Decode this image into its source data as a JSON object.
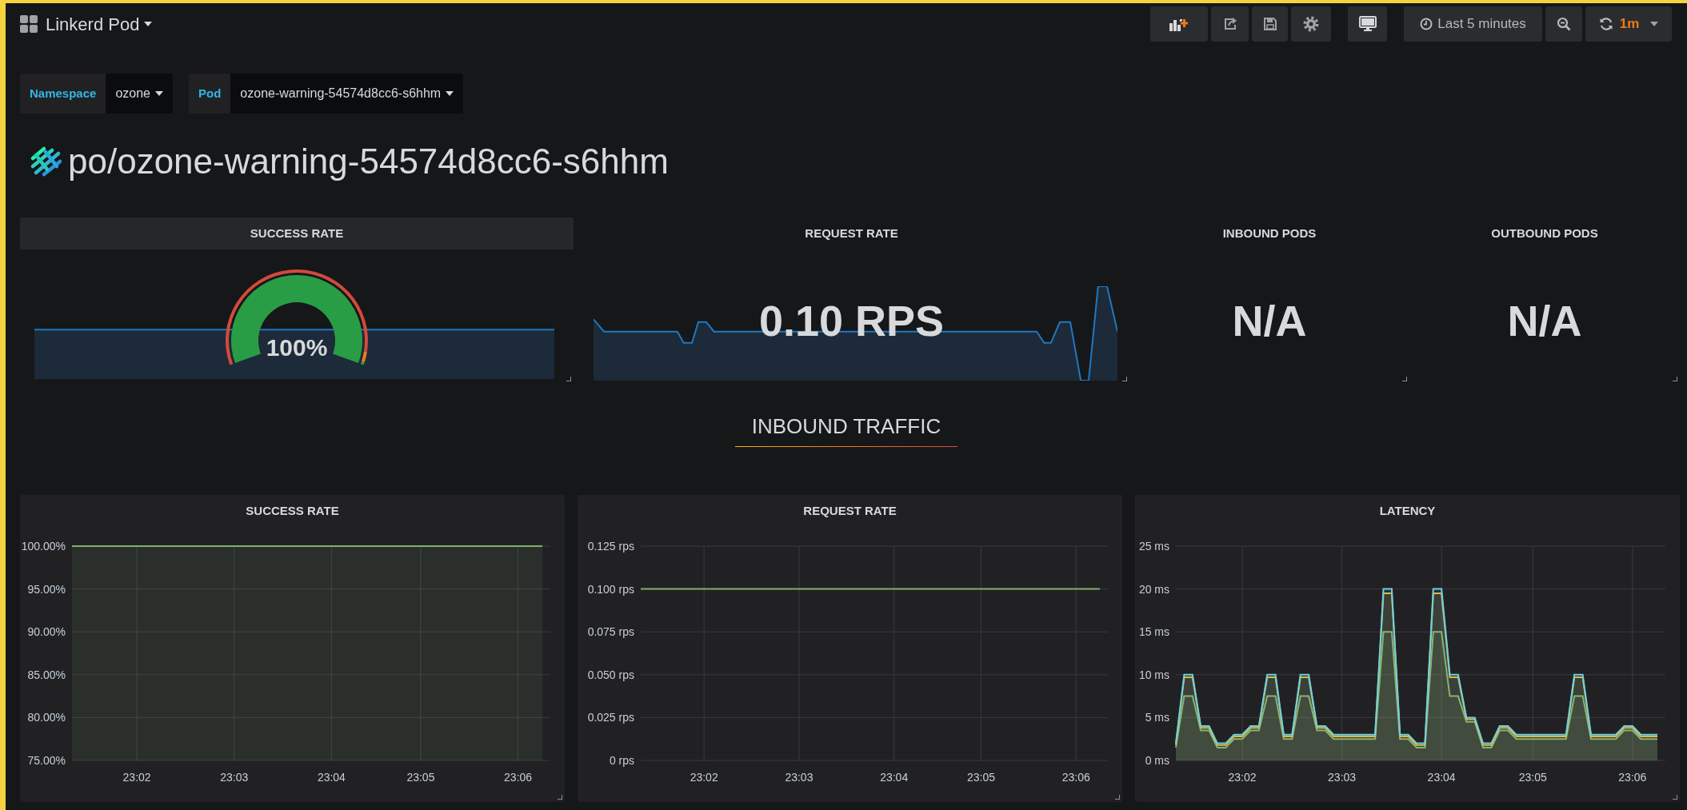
{
  "top_bar": {
    "title": "Linkerd Pod",
    "buttons": [
      {
        "kind": "add-panel"
      },
      {
        "kind": "share"
      },
      {
        "kind": "save"
      },
      {
        "kind": "settings"
      },
      {
        "kind": "tv"
      }
    ],
    "time_picker": "Last 5 minutes",
    "refresh_interval": "1m"
  },
  "variables": [
    {
      "label": "Namespace",
      "value": "ozone"
    },
    {
      "label": "Pod",
      "value": "ozone-warning-54574d8cc6-s6hhm"
    }
  ],
  "dashboard_title": "po/ozone-warning-54574d8cc6-s6hhm",
  "stats": [
    {
      "kind": "gauge",
      "title": "SUCCESS RATE",
      "value": "100%",
      "level": 1,
      "hovered": true
    },
    {
      "kind": "sparkline",
      "title": "REQUEST RATE",
      "value": "0.10 RPS",
      "hovered": false
    },
    {
      "kind": "plain",
      "title": "INBOUND PODS",
      "value": "N/A",
      "hovered": false
    },
    {
      "kind": "plain",
      "title": "OUTBOUND PODS",
      "value": "N/A",
      "hovered": false
    }
  ],
  "row_title": "INBOUND TRAFFIC",
  "graphs": [
    {
      "title": "SUCCESS RATE",
      "chart_data": {
        "type": "area",
        "grid": true,
        "categories": [
          null,
          null,
          null,
          null,
          null,
          null,
          null,
          null,
          "23:02",
          null,
          null,
          null,
          null,
          null,
          null,
          null,
          null,
          null,
          null,
          null,
          "23:03",
          null,
          null,
          null,
          null,
          null,
          null,
          null,
          null,
          null,
          null,
          null,
          "23:04",
          null,
          null,
          null,
          null,
          null,
          null,
          null,
          null,
          null,
          null,
          "23:05",
          null,
          null,
          null,
          null,
          null,
          null,
          null,
          null,
          null,
          null,
          null,
          "23:06",
          null,
          null,
          null
        ],
        "series": [
          {
            "color": "#7eb26d",
            "values": [
              100,
              100,
              100,
              100,
              100,
              100,
              100,
              100,
              100,
              100,
              100,
              100,
              100,
              100,
              100,
              100,
              100,
              100,
              100,
              100,
              100,
              100,
              100,
              100,
              100,
              100,
              100,
              100,
              100,
              100,
              100,
              100,
              100,
              100,
              100,
              100,
              100,
              100,
              100,
              100,
              100,
              100,
              100,
              100,
              100,
              100,
              100,
              100,
              100,
              100,
              100,
              100,
              100,
              100,
              100,
              100,
              100,
              100,
              100
            ]
          }
        ],
        "ylim": [
          75,
          100
        ],
        "yticks": [
          {
            "value": 75,
            "label": "75.00%"
          },
          {
            "value": 80,
            "label": "80.00%"
          },
          {
            "value": 85,
            "label": "85.00%"
          },
          {
            "value": 90,
            "label": "90.00%"
          },
          {
            "value": 95,
            "label": "95.00%"
          },
          {
            "value": 100,
            "label": "100.00%"
          }
        ]
      }
    },
    {
      "title": "REQUEST RATE",
      "chart_data": {
        "type": "line",
        "grid": true,
        "categories": [
          null,
          null,
          null,
          null,
          null,
          null,
          null,
          null,
          "23:02",
          null,
          null,
          null,
          null,
          null,
          null,
          null,
          null,
          null,
          null,
          null,
          "23:03",
          null,
          null,
          null,
          null,
          null,
          null,
          null,
          null,
          null,
          null,
          null,
          "23:04",
          null,
          null,
          null,
          null,
          null,
          null,
          null,
          null,
          null,
          null,
          "23:05",
          null,
          null,
          null,
          null,
          null,
          null,
          null,
          null,
          null,
          null,
          null,
          "23:06",
          null,
          null,
          null
        ],
        "series": [
          {
            "color": "#7eb26d",
            "values": [
              0.1,
              0.1,
              0.1,
              0.1,
              0.1,
              0.1,
              0.1,
              0.1,
              0.1,
              0.1,
              0.1,
              0.1,
              0.1,
              0.1,
              0.1,
              0.1,
              0.1,
              0.1,
              0.1,
              0.1,
              0.1,
              0.1,
              0.1,
              0.1,
              0.1,
              0.1,
              0.1,
              0.1,
              0.1,
              0.1,
              0.1,
              0.1,
              0.1,
              0.1,
              0.1,
              0.1,
              0.1,
              0.1,
              0.1,
              0.1,
              0.1,
              0.1,
              0.1,
              0.1,
              0.1,
              0.1,
              0.1,
              0.1,
              0.1,
              0.1,
              0.1,
              0.1,
              0.1,
              0.1,
              0.1,
              0.1,
              0.1,
              0.1,
              0.1
            ]
          }
        ],
        "ylim": [
          0,
          0.125
        ],
        "yticks": [
          {
            "value": 0,
            "label": "0 rps"
          },
          {
            "value": 0.025,
            "label": "0.025 rps"
          },
          {
            "value": 0.05,
            "label": "0.050 rps"
          },
          {
            "value": 0.075,
            "label": "0.075 rps"
          },
          {
            "value": 0.1,
            "label": "0.100 rps"
          },
          {
            "value": 0.125,
            "label": "0.125 rps"
          }
        ]
      }
    },
    {
      "title": "LATENCY",
      "chart_data": {
        "type": "area",
        "grid": true,
        "categories": [
          null,
          null,
          null,
          null,
          null,
          null,
          null,
          null,
          "23:02",
          null,
          null,
          null,
          null,
          null,
          null,
          null,
          null,
          null,
          null,
          null,
          "23:03",
          null,
          null,
          null,
          null,
          null,
          null,
          null,
          null,
          null,
          null,
          null,
          "23:04",
          null,
          null,
          null,
          null,
          null,
          null,
          null,
          null,
          null,
          null,
          "23:05",
          null,
          null,
          null,
          null,
          null,
          null,
          null,
          null,
          null,
          null,
          null,
          "23:06",
          null,
          null,
          null
        ],
        "series": [
          {
            "color": "#7eb26d",
            "values": [
              1.5,
              7.5,
              7.5,
              3.5,
              3.5,
              1.5,
              1.5,
              2.5,
              2.5,
              3.5,
              3.5,
              7.5,
              7.5,
              2.5,
              2.5,
              7.5,
              7.5,
              3.5,
              3.5,
              2.5,
              2.5,
              2.5,
              2.5,
              2.5,
              2.5,
              15,
              15,
              2.5,
              2.5,
              1.5,
              1.5,
              15,
              15,
              7.5,
              7.5,
              4.5,
              4.5,
              1.5,
              1.5,
              3.5,
              3.5,
              2.5,
              2.5,
              2.5,
              2.5,
              2.5,
              2.5,
              2.5,
              7.5,
              7.5,
              2.5,
              2.5,
              2.5,
              2.5,
              3.5,
              3.5,
              2.5,
              2.5,
              2.5
            ]
          },
          {
            "color": "#eab839",
            "values": [
              1.8,
              9.7,
              9.7,
              3.8,
              3.8,
              1.8,
              1.8,
              2.8,
              2.8,
              3.8,
              3.8,
              9.7,
              9.7,
              2.8,
              2.8,
              9.7,
              9.7,
              3.8,
              3.8,
              2.8,
              2.8,
              2.8,
              2.8,
              2.8,
              2.8,
              19.5,
              19.5,
              2.8,
              2.8,
              1.8,
              1.8,
              19.5,
              19.5,
              9.7,
              9.7,
              4.8,
              4.8,
              1.8,
              1.8,
              3.8,
              3.8,
              2.8,
              2.8,
              2.8,
              2.8,
              2.8,
              2.8,
              2.8,
              9.7,
              9.7,
              2.8,
              2.8,
              2.8,
              2.8,
              3.8,
              3.8,
              2.8,
              2.8,
              2.8
            ]
          },
          {
            "color": "#6ed0e0",
            "values": [
              2,
              10,
              10,
              4,
              4,
              2,
              2,
              3,
              3,
              4,
              4,
              10,
              10,
              3,
              3,
              10,
              10,
              4,
              4,
              3,
              3,
              3,
              3,
              3,
              3,
              20,
              20,
              3,
              3,
              2,
              2,
              20,
              20,
              10,
              10,
              5,
              5,
              2,
              2,
              4,
              4,
              3,
              3,
              3,
              3,
              3,
              3,
              3,
              10,
              10,
              3,
              3,
              3,
              3,
              4,
              4,
              3,
              3,
              3
            ]
          }
        ],
        "ylim": [
          0,
          25
        ],
        "yticks": [
          {
            "value": 0,
            "label": "0 ms"
          },
          {
            "value": 5,
            "label": "5 ms"
          },
          {
            "value": 10,
            "label": "10 ms"
          },
          {
            "value": 15,
            "label": "15 ms"
          },
          {
            "value": 20,
            "label": "20 ms"
          },
          {
            "value": 25,
            "label": "25 ms"
          }
        ]
      }
    }
  ]
}
